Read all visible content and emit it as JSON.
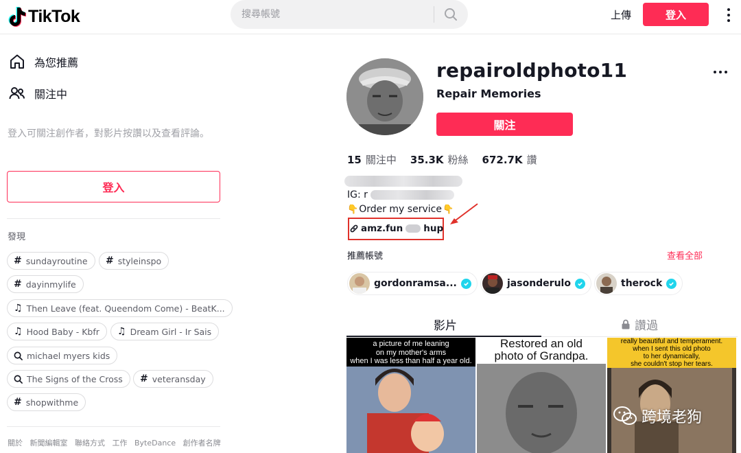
{
  "header": {
    "brand": "TikTok",
    "search_placeholder": "搜尋帳號",
    "upload_label": "上傳",
    "login_label": "登入"
  },
  "sidebar": {
    "nav": [
      {
        "label": "為您推薦",
        "icon": "home-icon"
      },
      {
        "label": "關注中",
        "icon": "users-icon"
      }
    ],
    "login_hint": "登入可關注創作者，對影片按讚以及查看評論。",
    "login_button": "登入",
    "discover_title": "發現",
    "tags": [
      {
        "label": "sundayroutine",
        "kind": "hashtag"
      },
      {
        "label": "styleinspo",
        "kind": "hashtag"
      },
      {
        "label": "dayinmylife",
        "kind": "hashtag"
      },
      {
        "label": "Then Leave (feat. Queendom Come) - BeatK...",
        "kind": "music"
      },
      {
        "label": "Hood Baby - Kbfr",
        "kind": "music"
      },
      {
        "label": "Dream Girl - Ir Sais",
        "kind": "music"
      },
      {
        "label": "michael myers kids",
        "kind": "search"
      },
      {
        "label": "The Signs of the Cross",
        "kind": "search"
      },
      {
        "label": "veteransday",
        "kind": "hashtag"
      },
      {
        "label": "shopwithme",
        "kind": "hashtag"
      }
    ],
    "footer_links": [
      "關於",
      "新聞編輯室",
      "聯絡方式",
      "工作",
      "ByteDance",
      "創作者名牌"
    ]
  },
  "profile": {
    "username": "repairoldphoto11",
    "nickname": "Repair Memories",
    "follow_label": "關注",
    "stats": [
      {
        "value": "15",
        "label": "關注中"
      },
      {
        "value": "35.3K",
        "label": "粉絲"
      },
      {
        "value": "672.7K",
        "label": "讚"
      }
    ],
    "bio_ig_prefix": "IG: r",
    "bio_service": "Order my service",
    "link_prefix": "amz.fun",
    "link_suffix": "hup"
  },
  "suggested": {
    "title": "推薦帳號",
    "see_all": "查看全部",
    "accounts": [
      {
        "name": "gordonramsa..."
      },
      {
        "name": "jasonderulo"
      },
      {
        "name": "therock"
      }
    ]
  },
  "tabs": {
    "videos": "影片",
    "liked": "讚過"
  },
  "videos": [
    {
      "caption_lines": [
        "a picture of me leaning",
        "on my mother's arms",
        "when I was less than half a year old."
      ]
    },
    {
      "caption_lines": [
        "Restored an old",
        "photo  of Grandpa."
      ]
    },
    {
      "caption_lines": [
        "really beautiful and temperament.",
        "when I sent this old photo",
        "to her dynamically,",
        "she couldn't stop her tears."
      ]
    }
  ],
  "watermark": "跨境老狗",
  "colors": {
    "accent": "#fe2c55",
    "verified": "#20d5ec",
    "annotation": "#e0312a"
  }
}
